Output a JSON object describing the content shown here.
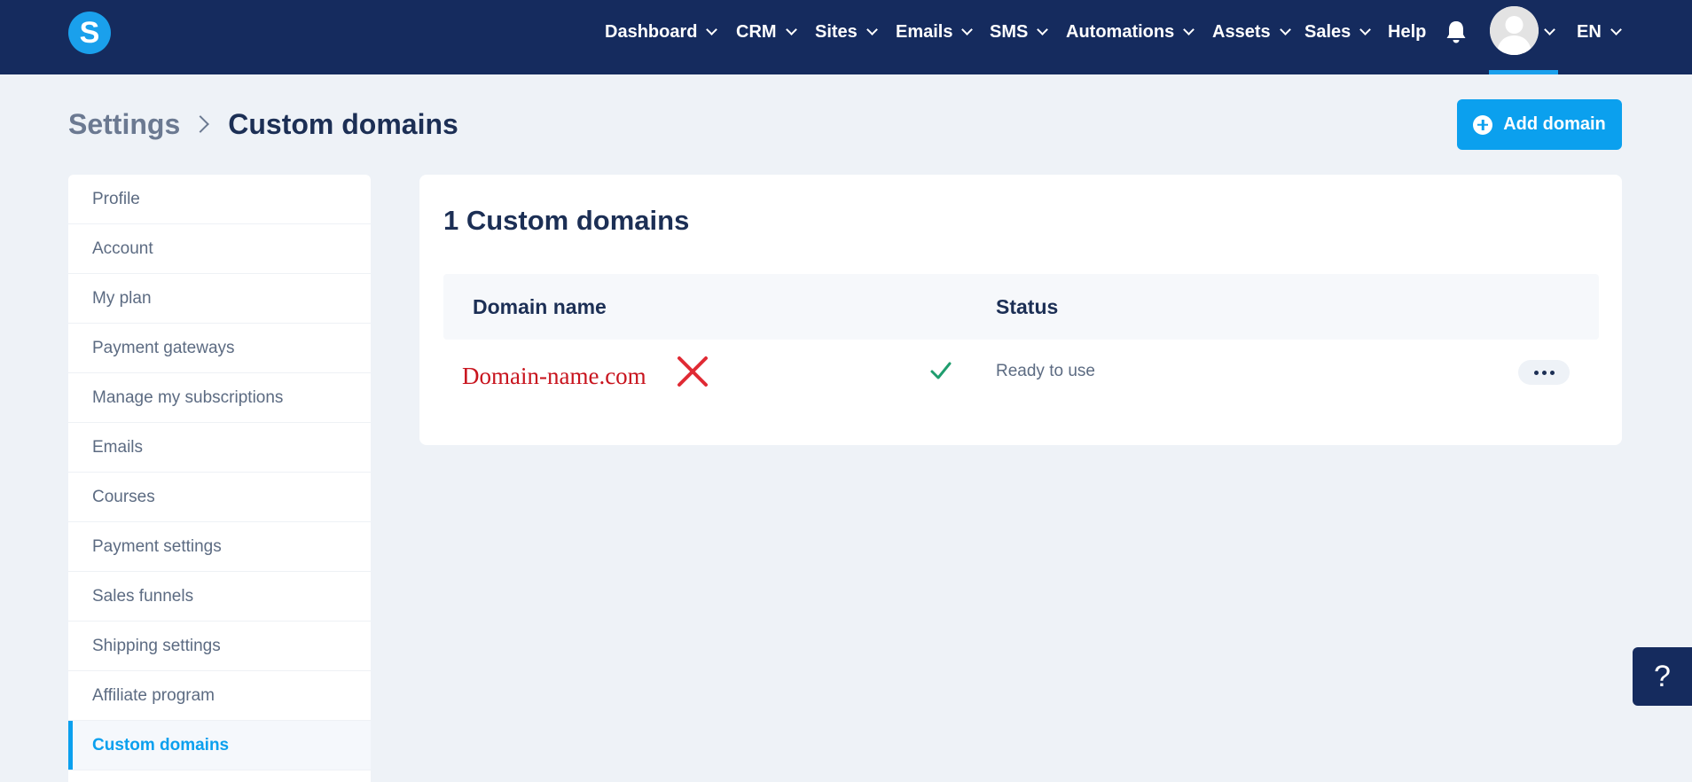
{
  "brand": {
    "logo_letter": "S",
    "accent": "#1aa0ec",
    "navbar_bg": "#152b5e"
  },
  "nav": {
    "items": [
      {
        "label": "Dashboard",
        "dropdown": true
      },
      {
        "label": "CRM",
        "dropdown": true
      },
      {
        "label": "Sites",
        "dropdown": true
      },
      {
        "label": "Emails",
        "dropdown": true
      },
      {
        "label": "SMS",
        "dropdown": true
      },
      {
        "label": "Automations",
        "dropdown": true
      },
      {
        "label": "Assets",
        "dropdown": true
      },
      {
        "label": "Sales",
        "dropdown": true
      },
      {
        "label": "Help",
        "dropdown": false
      }
    ],
    "notifications_icon": "bell-icon",
    "avatar_icon": "user-avatar",
    "language": "EN"
  },
  "header": {
    "breadcrumb_root": "Settings",
    "breadcrumb_current": "Custom domains",
    "add_button_label": "Add domain",
    "add_button_icon": "plus-circle-icon"
  },
  "sidebar": {
    "items": [
      {
        "label": "Profile"
      },
      {
        "label": "Account"
      },
      {
        "label": "My plan"
      },
      {
        "label": "Payment gateways"
      },
      {
        "label": "Manage my subscriptions"
      },
      {
        "label": "Emails"
      },
      {
        "label": "Courses"
      },
      {
        "label": "Payment settings"
      },
      {
        "label": "Sales funnels"
      },
      {
        "label": "Shipping settings"
      },
      {
        "label": "Affiliate program"
      },
      {
        "label": "Custom domains",
        "active": true
      }
    ]
  },
  "main": {
    "title": "1 Custom domains",
    "columns": {
      "domain": "Domain name",
      "status": "Status"
    },
    "rows": [
      {
        "domain": "Domain-name.com",
        "annotation_icon": "red-x-icon",
        "status_icon": "check-icon",
        "status": "Ready to use",
        "actions_icon": "more-dots-icon"
      }
    ]
  },
  "help_button": {
    "label": "?"
  },
  "colors": {
    "status_ok": "#1f9d6e",
    "annotation_red": "#e02a34",
    "button_blue": "#0ba0ee"
  }
}
